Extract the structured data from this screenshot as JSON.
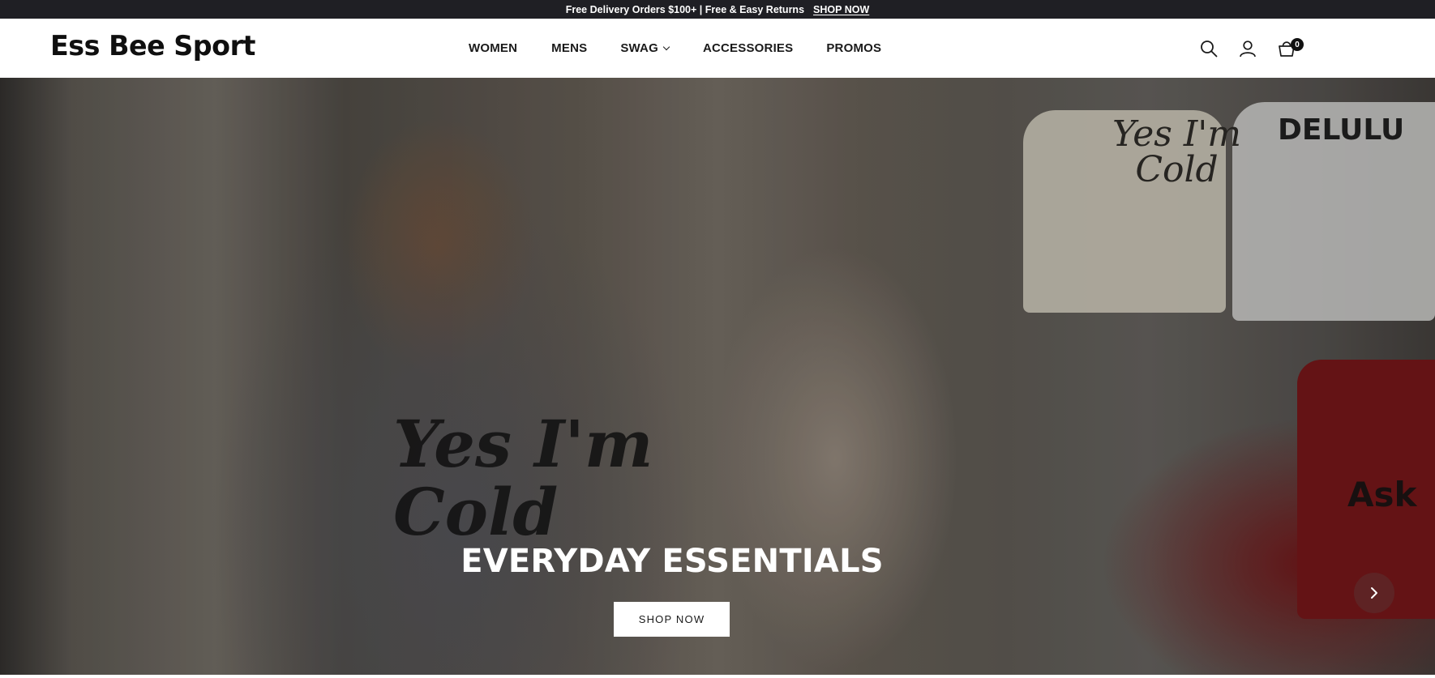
{
  "announcement": {
    "text": "Free Delivery Orders $100+ | Free & Easy Returns",
    "link_label": "SHOP NOW"
  },
  "header": {
    "logo": "Ess Bee Sport",
    "nav": [
      {
        "label": "WOMEN"
      },
      {
        "label": "MENS"
      },
      {
        "label": "SWAG"
      },
      {
        "label": "ACCESSORIES"
      },
      {
        "label": "PROMOS"
      }
    ],
    "icons": [
      "search-icon",
      "account-icon",
      "cart-icon"
    ],
    "cart_count": "0"
  },
  "hero": {
    "title": "EVERYDAY ESSENTIALS",
    "cta_label": "SHOP NOW",
    "shirt_text_1": "Yes I'm\nCold",
    "shirt_text_2": "DELULU",
    "red_shirt_text": "Ask",
    "sweater_text": "Yes I'm\nCold",
    "next_icon": "chevron-right-icon"
  },
  "colors": {
    "announcement_bg": "#1f1f24",
    "header_bg": "#ffffff",
    "cta_bg": "#ffffff"
  }
}
